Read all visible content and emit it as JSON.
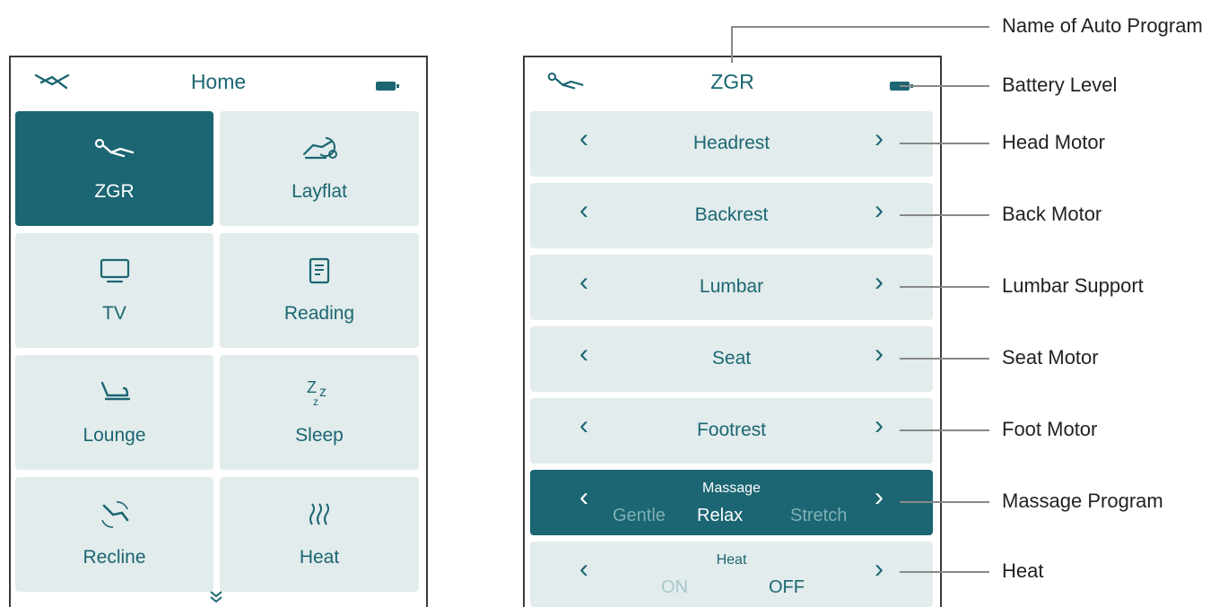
{
  "home": {
    "title": "Home",
    "tiles": [
      {
        "label": "ZGR",
        "icon": "zero-gravity-icon",
        "selected": true
      },
      {
        "label": "Layflat",
        "icon": "layflat-icon",
        "selected": false
      },
      {
        "label": "TV",
        "icon": "tv-icon",
        "selected": false
      },
      {
        "label": "Reading",
        "icon": "book-icon",
        "selected": false
      },
      {
        "label": "Lounge",
        "icon": "lounge-chair-icon",
        "selected": false
      },
      {
        "label": "Sleep",
        "icon": "sleep-zzz-icon",
        "selected": false
      },
      {
        "label": "Recline",
        "icon": "recline-icon",
        "selected": false
      },
      {
        "label": "Heat",
        "icon": "heat-waves-icon",
        "selected": false
      }
    ],
    "more_icon": "double-chevron-down-icon"
  },
  "zgr": {
    "title": "ZGR",
    "rows": [
      {
        "label": "Headrest"
      },
      {
        "label": "Backrest"
      },
      {
        "label": "Lumbar"
      },
      {
        "label": "Seat"
      },
      {
        "label": "Footrest"
      }
    ],
    "massage": {
      "caption": "Massage",
      "options": [
        "Gentle",
        "Relax",
        "Stretch"
      ],
      "selected": "Relax"
    },
    "heat": {
      "caption": "Heat",
      "options": [
        "ON",
        "OFF"
      ],
      "selected": "OFF"
    }
  },
  "annotations": [
    "Name of Auto Program",
    "Battery Level",
    "Head Motor",
    "Back Motor",
    "Lumbar Support",
    "Seat Motor",
    "Foot Motor",
    "Massage Program",
    "Heat"
  ],
  "colors": {
    "accent": "#1b6672",
    "tile": "#e2ecec",
    "dim_option": "#7fb0b5"
  }
}
